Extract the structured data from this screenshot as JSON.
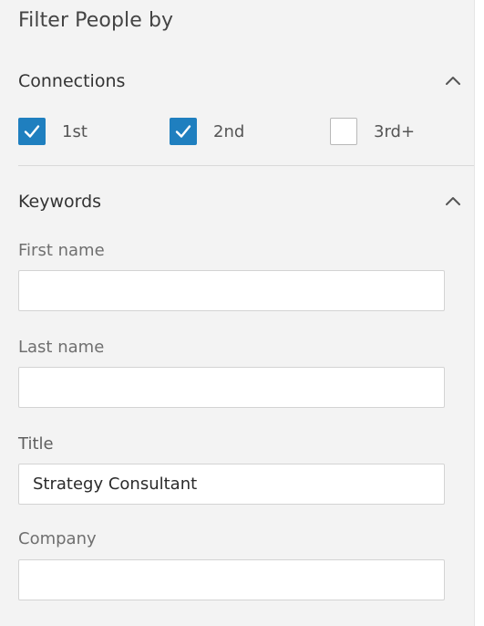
{
  "panel": {
    "title": "Filter People by"
  },
  "connections": {
    "title": "Connections",
    "options": [
      {
        "label": "1st",
        "checked": true
      },
      {
        "label": "2nd",
        "checked": true
      },
      {
        "label": "3rd+",
        "checked": false
      }
    ]
  },
  "keywords": {
    "title": "Keywords",
    "fields": {
      "first_name": {
        "label": "First name",
        "value": ""
      },
      "last_name": {
        "label": "Last name",
        "value": ""
      },
      "title": {
        "label": "Title",
        "value": "Strategy Consultant"
      },
      "company": {
        "label": "Company",
        "value": ""
      }
    }
  },
  "colors": {
    "checkbox_checked": "#1f7fbf",
    "panel_background": "#f3f3f3"
  },
  "icons": {
    "collapse": "chevron-up-icon",
    "check": "checkmark-icon"
  }
}
